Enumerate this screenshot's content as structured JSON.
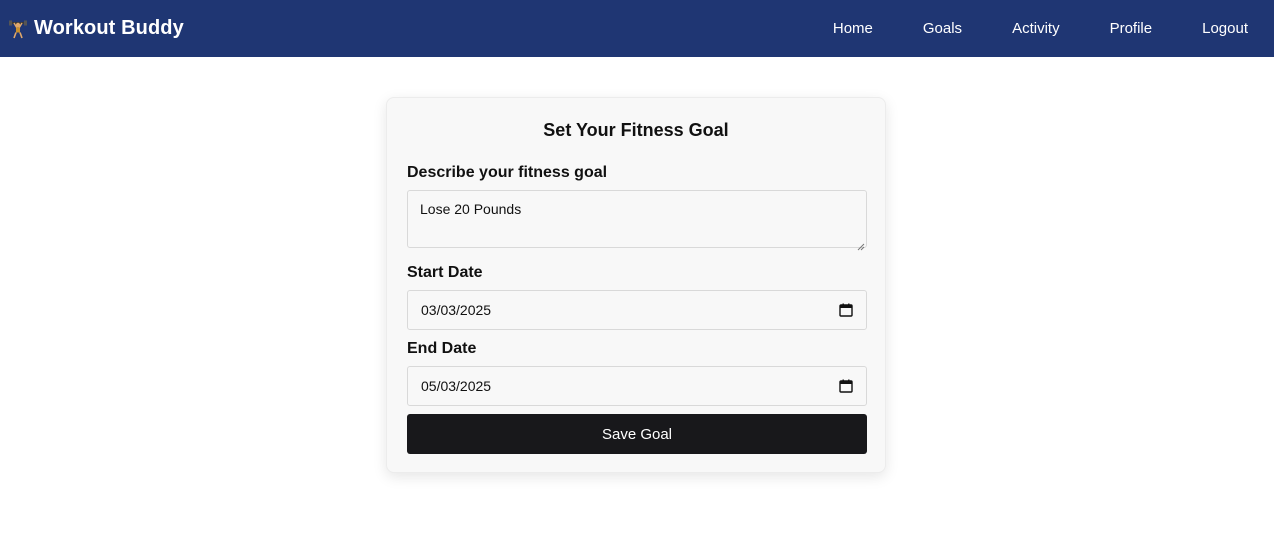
{
  "app": {
    "brand_name": "Workout Buddy",
    "brand_icon": "weightlifter-icon",
    "nav_bg_color": "#1f3673"
  },
  "nav": {
    "items": [
      {
        "label": "Home"
      },
      {
        "label": "Goals"
      },
      {
        "label": "Activity"
      },
      {
        "label": "Profile"
      },
      {
        "label": "Logout"
      }
    ]
  },
  "form": {
    "title": "Set Your Fitness Goal",
    "goal_label": "Describe your fitness goal",
    "goal_value": "Lose 20 Pounds",
    "start_label": "Start Date",
    "start_value": "03/03/2025",
    "end_label": "End Date",
    "end_value": "05/03/2025",
    "calendar_icon": "calendar-icon",
    "save_label": "Save Goal",
    "save_color": "#18181b"
  }
}
